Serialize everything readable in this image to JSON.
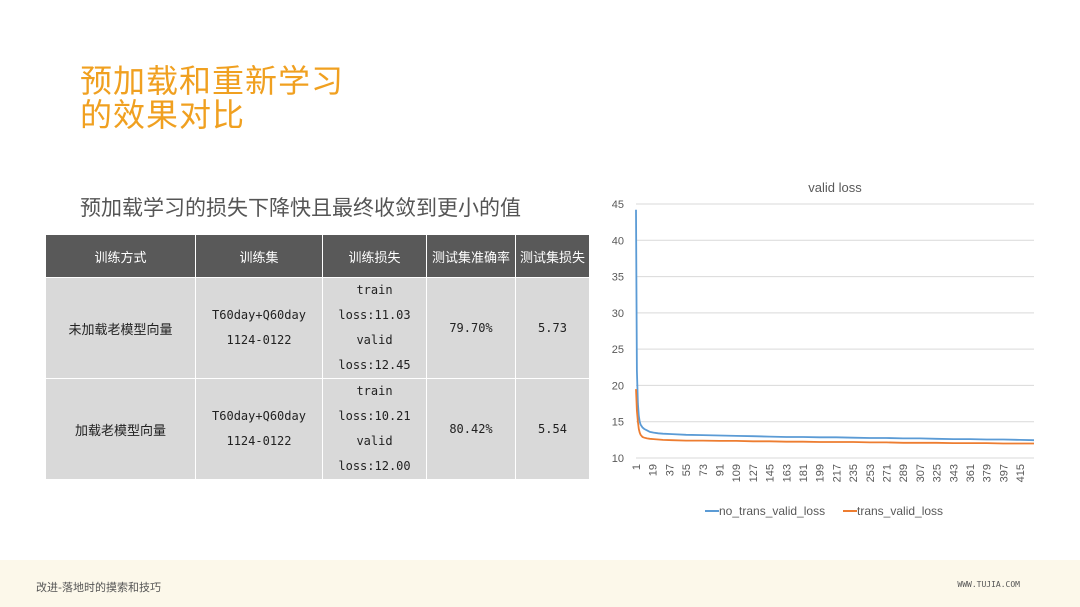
{
  "title": {
    "line1": "预加载和重新学习",
    "line2": "的效果对比"
  },
  "subtitle": "预加载学习的损失下降快且最终收敛到更小的值",
  "table": {
    "headers": [
      "训练方式",
      "训练集",
      "训练损失",
      "测试集准确率",
      "测试集损失"
    ],
    "rows": [
      {
        "method": "未加载老模型向量",
        "train_set": [
          "T60day+Q60day",
          "1124-0122"
        ],
        "train_loss": [
          "train",
          "loss:11.03",
          "valid",
          "loss:12.45"
        ],
        "acc": "79.70%",
        "test_loss": "5.73"
      },
      {
        "method": "加载老模型向量",
        "train_set": [
          "T60day+Q60day",
          "1124-0122"
        ],
        "train_loss": [
          "train",
          "loss:10.21",
          "valid",
          "loss:12.00"
        ],
        "acc": "80.42%",
        "test_loss": "5.54"
      }
    ]
  },
  "chart_data": {
    "type": "line",
    "title": "valid loss",
    "xlabel": "",
    "ylabel": "",
    "ylim": [
      10,
      45
    ],
    "yticks": [
      10,
      15,
      20,
      25,
      30,
      35,
      40,
      45
    ],
    "xlim": [
      1,
      430
    ],
    "xticks": [
      "1",
      "19",
      "37",
      "55",
      "73",
      "91",
      "109",
      "127",
      "145",
      "163",
      "181",
      "199",
      "217",
      "235",
      "253",
      "271",
      "289",
      "307",
      "325",
      "343",
      "361",
      "379",
      "397",
      "415"
    ],
    "legend_position": "bottom",
    "grid": true,
    "series": [
      {
        "name": "no_trans_valid_loss",
        "color": "#5b9bd5",
        "x": [
          1,
          2,
          3,
          4,
          5,
          6,
          8,
          10,
          13,
          16,
          20,
          25,
          30,
          40,
          55,
          73,
          91,
          109,
          127,
          145,
          163,
          181,
          199,
          217,
          235,
          253,
          271,
          289,
          307,
          325,
          343,
          361,
          379,
          397,
          415,
          430
        ],
        "y": [
          44.2,
          22,
          17.5,
          15.8,
          15.0,
          14.6,
          14.2,
          14.0,
          13.8,
          13.6,
          13.5,
          13.4,
          13.35,
          13.3,
          13.2,
          13.15,
          13.1,
          13.05,
          13.0,
          12.95,
          12.9,
          12.9,
          12.85,
          12.85,
          12.8,
          12.75,
          12.75,
          12.7,
          12.7,
          12.65,
          12.6,
          12.6,
          12.55,
          12.55,
          12.5,
          12.45
        ]
      },
      {
        "name": "trans_valid_loss",
        "color": "#ed7d31",
        "x": [
          1,
          2,
          3,
          4,
          5,
          6,
          8,
          10,
          13,
          16,
          20,
          25,
          30,
          40,
          55,
          73,
          91,
          109,
          127,
          145,
          163,
          181,
          199,
          217,
          235,
          253,
          271,
          289,
          307,
          325,
          343,
          361,
          379,
          397,
          415,
          430
        ],
        "y": [
          19.5,
          16.5,
          15.0,
          14.0,
          13.5,
          13.2,
          12.9,
          12.8,
          12.7,
          12.65,
          12.6,
          12.55,
          12.5,
          12.45,
          12.4,
          12.4,
          12.35,
          12.35,
          12.3,
          12.3,
          12.25,
          12.25,
          12.2,
          12.2,
          12.2,
          12.15,
          12.15,
          12.1,
          12.1,
          12.1,
          12.05,
          12.05,
          12.05,
          12.0,
          12.0,
          12.0
        ]
      }
    ]
  },
  "footer": {
    "left": "改进-落地时的摸索和技巧",
    "right": "WWW.TUJIA.COM"
  },
  "colors": {
    "accent": "#f0a020",
    "header_bg": "#595959",
    "cell_bg": "#d9d9d9",
    "footer_bg": "#fcf8ea"
  }
}
